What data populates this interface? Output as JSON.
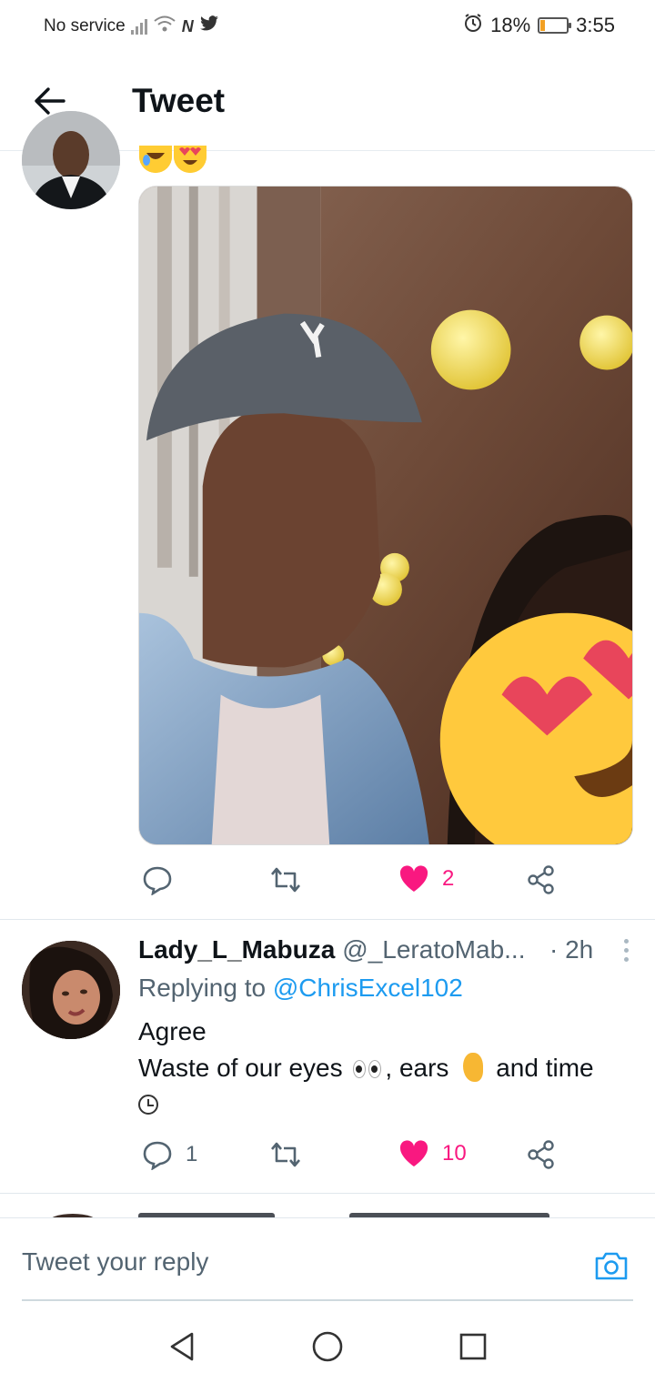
{
  "status_bar": {
    "carrier": "No service",
    "network_glyph": "N",
    "battery_percent": "18%",
    "battery_level": 0.18,
    "time": "3:55",
    "icons": [
      "signal-icon",
      "wifi-icon",
      "nfc-icon",
      "twitter-icon",
      "alarm-icon",
      "battery-icon"
    ]
  },
  "header": {
    "back_icon": "arrow-left-icon",
    "title": "Tweet"
  },
  "tweet1": {
    "emoji": [
      "rolling-on-floor-laughing",
      "heart-eyes"
    ],
    "media_icon": "photo-image",
    "actions": {
      "reply_count": "",
      "retweet_count": "",
      "like_count": "2",
      "liked": true
    }
  },
  "tweet2": {
    "display_name": "Lady_L_Mabuza",
    "handle": "@_LeratoMab...",
    "time": "· 2h",
    "replying_prefix": "Replying to",
    "replying_to": "@ChrisExcel102",
    "body_line1": "Agree",
    "body_line2_start": "Waste of our eyes",
    "body_line2_mid": ", ears",
    "body_line2_end": "and time",
    "actions": {
      "reply_count": "1",
      "retweet_count": "",
      "like_count": "10",
      "liked": true
    }
  },
  "composer": {
    "placeholder": "Tweet your reply",
    "camera_icon": "camera-icon"
  },
  "navbar": {
    "icons": [
      "back-triangle-icon",
      "home-circle-icon",
      "recents-square-icon"
    ]
  },
  "colors": {
    "like_pink": "#f91880",
    "link_blue": "#1d9bf0",
    "secondary_text": "#536471",
    "divider": "#e1e8ed"
  }
}
